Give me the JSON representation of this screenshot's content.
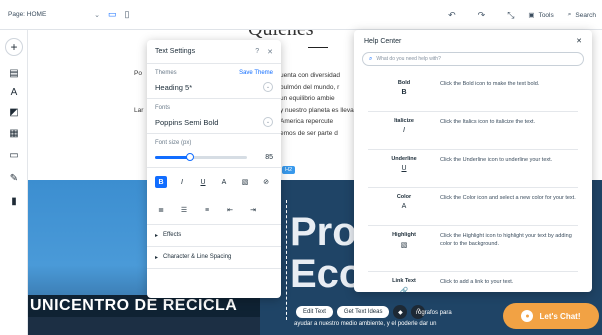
{
  "topbar": {
    "page_label": "Page: HOME",
    "tools_label": "Tools",
    "search_label": "Search"
  },
  "canvas": {
    "heading": "Quiénes",
    "paragraph": "uenta con diversidad\npulmón del mundo, r\nun equilibrio ambie\ny nuestro planeta es llevar\nAmerica repercute\nemos de ser parte d",
    "side_text_1": "Po",
    "side_text_2": "Lar",
    "sign_text": "UNICENTRO DE RECICLA",
    "big_text_1": "Pro",
    "big_text_2": "Eco",
    "body_copy": "ayudar a nuestro medio ambiente, y el poderle dar un",
    "body_copy_right": "rógrafos para",
    "selection_tag": "H2",
    "edit_text_label": "Edit Text",
    "get_text_ideas_label": "Get Text Ideas",
    "chat_label": "Let's Chat!"
  },
  "text_settings": {
    "title": "Text Settings",
    "themes_label": "Themes",
    "save_theme_label": "Save Theme",
    "theme_value": "Heading 5*",
    "fonts_label": "Fonts",
    "font_value": "Poppins Semi Bold",
    "font_size_label": "Font size (px)",
    "font_size_value": "85",
    "font_size_fraction": 0.38,
    "effects_label": "Effects",
    "spacing_label": "Character & Line Spacing"
  },
  "help_center": {
    "title": "Help Center",
    "search_placeholder": "What do you need help with?",
    "rows": [
      {
        "name": "Bold",
        "icon": "B",
        "desc": "Click the Bold icon to make the text bold."
      },
      {
        "name": "Italicize",
        "icon": "I",
        "desc": "Click the Italics icon to italicize the text."
      },
      {
        "name": "Underline",
        "icon": "U",
        "desc": "Click the Underline icon to underline your text."
      },
      {
        "name": "Color",
        "icon": "A",
        "desc": "Click the Color icon and select a new color for your text."
      },
      {
        "name": "Highlight",
        "icon": "▧",
        "desc": "Click the Highlight icon to highlight your text by adding color to the background."
      },
      {
        "name": "Link Text",
        "icon": "🔗",
        "desc": "Click to add a link to your text."
      }
    ]
  },
  "colors": {
    "accent": "#116dff",
    "chat": "#f2a244",
    "section_blue": "#2f86c6"
  }
}
